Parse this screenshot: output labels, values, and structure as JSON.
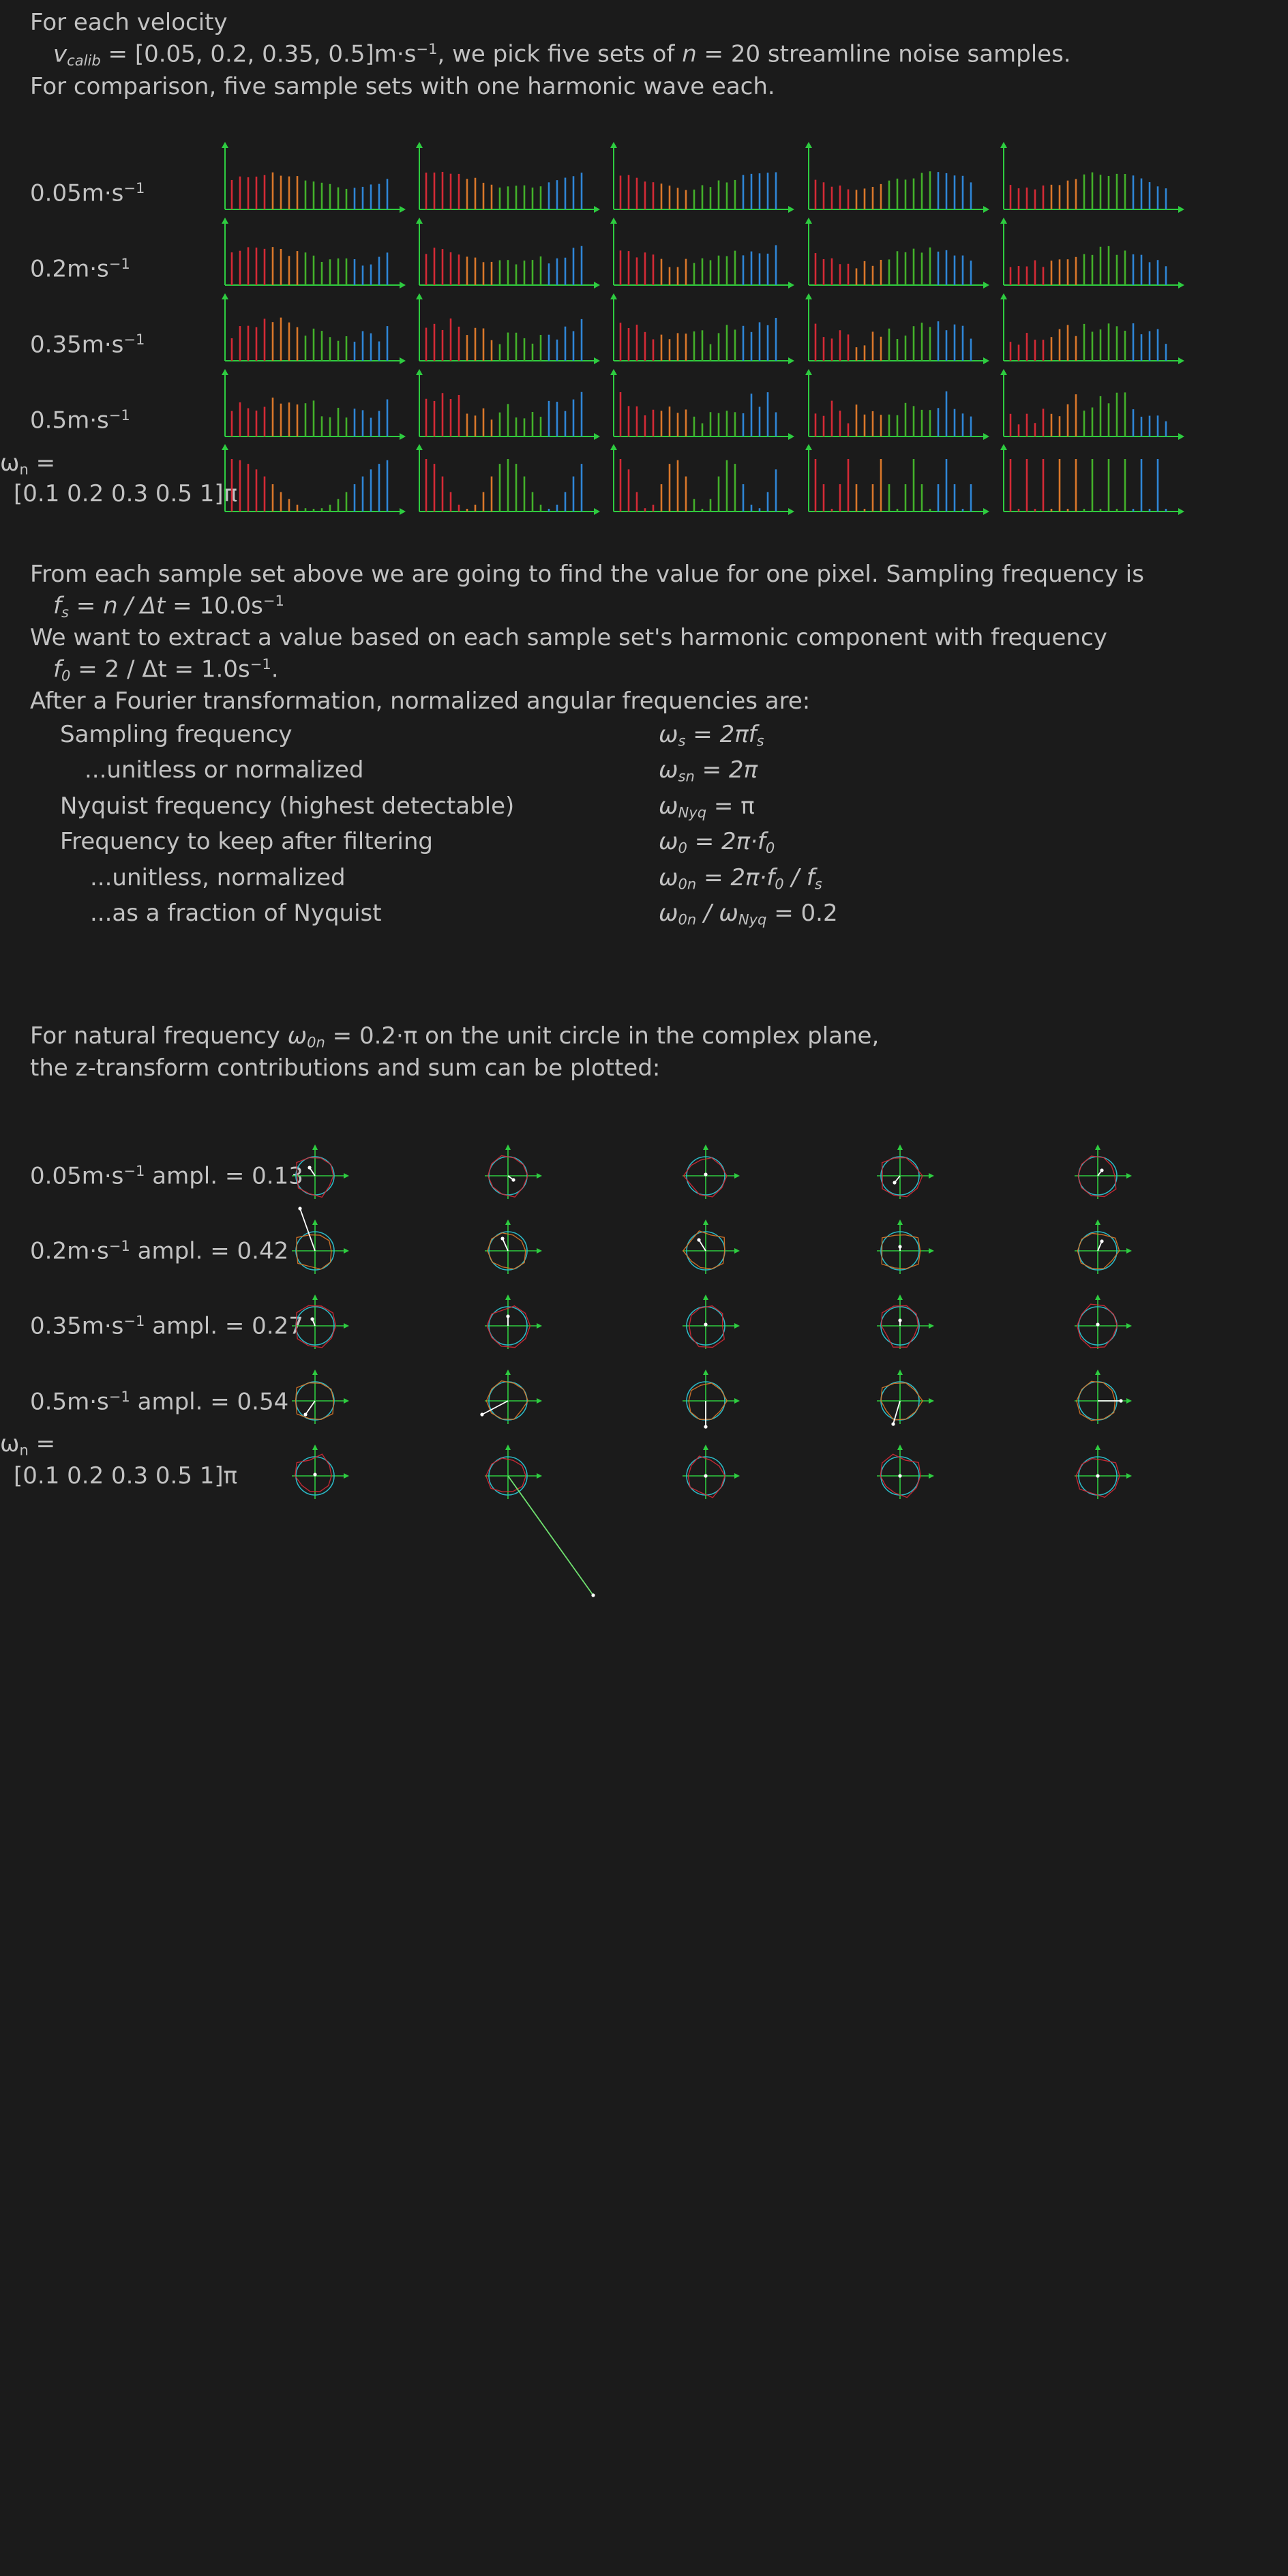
{
  "intro": {
    "line1": "For each velocity",
    "vcalib_sym": "v",
    "vcalib_sub": "calib",
    "vcalib_eq": " = [0.05, 0.2, 0.35, 0.5]m·s",
    "vcalib_sup": "−1",
    "vcalib_tail_a": ", we pick five sets of ",
    "vcalib_n": "n",
    "vcalib_tail_b": " = 20 streamline noise samples.",
    "line3": "For comparison, five sample sets with one harmonic wave each."
  },
  "rows": [
    {
      "unit": "m·s",
      "sup": "−1",
      "value": "0.05",
      "ampl": " ampl. = 0.13"
    },
    {
      "unit": "m·s",
      "sup": "−1",
      "value": "0.2",
      "ampl": " ampl. = 0.42"
    },
    {
      "unit": "m·s",
      "sup": "−1",
      "value": "0.35",
      "ampl": " ampl. = 0.27"
    },
    {
      "unit": "m·s",
      "sup": "−1",
      "value": "0.5",
      "ampl": " ampl. = 0.54"
    }
  ],
  "omega_row": {
    "line1": "ω",
    "line1_sub": "n",
    "line1_tail": " =",
    "line2": "[0.1 0.2 0.3 0.5 1]π"
  },
  "sampling": {
    "line1": "From each sample set above we are going to find the value for one pixel. Sampling frequency is",
    "fs_sym": "f",
    "fs_sub": "s",
    "fs_eq": " = n / Δt",
    "fs_val": "  =  10.0s",
    "fs_sup": "−1",
    "line3": "We want to extract a value based on each sample set's harmonic component with frequency",
    "f0_sym": "f",
    "f0_sub": "0",
    "f0_val": " = 2 / Δt = 1.0s",
    "f0_sup": "−1",
    "f0_end": ".",
    "line5": "After a Fourier transformation, normalized angular frequencies are:"
  },
  "freq_table": [
    {
      "label": "Sampling frequency",
      "sym": "ω",
      "sub": "s",
      "rhs": " = 2πf",
      "rhs_sub": "s",
      "tail": ""
    },
    {
      "label": "...unitless or normalized",
      "sym": "ω",
      "sub": "sn",
      "rhs": " = 2π",
      "rhs_sub": "",
      "tail": ""
    },
    {
      "label": "Nyquist frequency (highest detectable)",
      "sym": "ω",
      "sub": "Nyq",
      "rhs": "",
      "rhs_sub": "",
      "tail": " = π"
    },
    {
      "label": "Frequency to keep after filtering",
      "sym": "ω",
      "sub": "0",
      "rhs": " = 2π·f",
      "rhs_sub": "0",
      "tail": ""
    },
    {
      "label": "...unitless, normalized",
      "sym": "ω",
      "sub": "0n",
      "rhs": " = 2π·f",
      "rhs_sub": "0",
      "tail": " / f",
      "tail_sub": "s"
    },
    {
      "label": "...as a fraction of Nyquist",
      "sym": "ω",
      "sub": "0n",
      "rhs": " / ω",
      "rhs_sub": "Nyq",
      "tail": " = 0.2"
    }
  ],
  "ztransform": {
    "line1_a": "For natural frequency ",
    "sym": "ω",
    "sub": "0n",
    "line1_b": " = 0.2·π on the unit circle in the complex plane,",
    "line2": "the z-transform contributions and sum can be plotted:"
  },
  "colors": {
    "background": "#1b1b1b",
    "text": "#c2c2c2",
    "axis": "#2ecc40",
    "red": "#d42a36",
    "orange": "#d9772a",
    "green": "#43b02a",
    "blue": "#2f86d6",
    "cyan": "#2bb8c4",
    "vector": "#ffffff"
  }
}
